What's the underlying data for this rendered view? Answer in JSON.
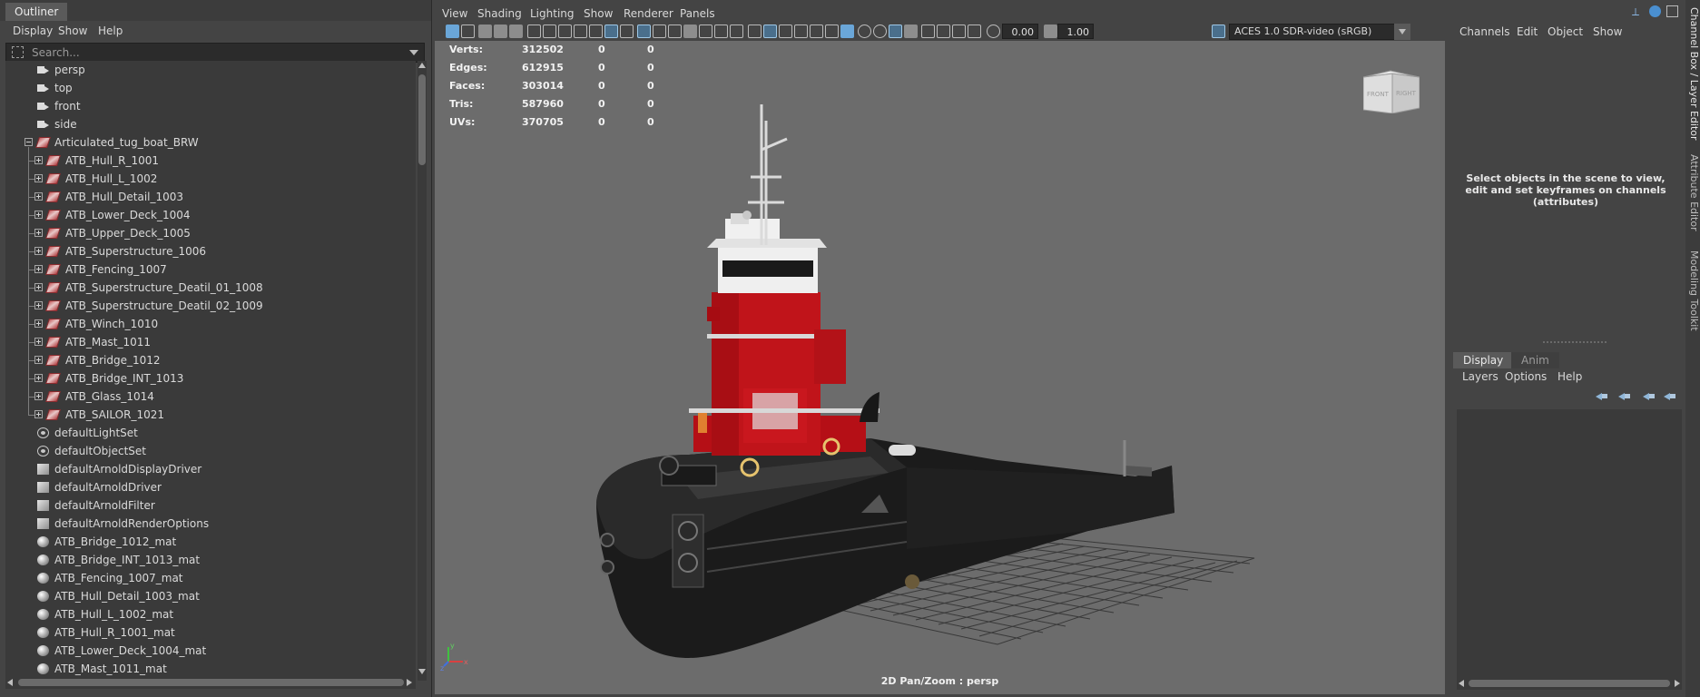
{
  "outliner": {
    "title": "Outliner",
    "menu": [
      "Display",
      "Show",
      "Help"
    ],
    "search_placeholder": "Search...",
    "items": [
      {
        "label": "persp",
        "kind": "camera",
        "indent": 0
      },
      {
        "label": "top",
        "kind": "camera",
        "indent": 0
      },
      {
        "label": "front",
        "kind": "camera",
        "indent": 0
      },
      {
        "label": "side",
        "kind": "camera",
        "indent": 0
      },
      {
        "label": "Articulated_tug_boat_BRW",
        "kind": "group",
        "indent": 0,
        "expanded": true
      },
      {
        "label": "ATB_Hull_R_1001",
        "kind": "mesh",
        "indent": 1
      },
      {
        "label": "ATB_Hull_L_1002",
        "kind": "mesh",
        "indent": 1
      },
      {
        "label": "ATB_Hull_Detail_1003",
        "kind": "mesh",
        "indent": 1
      },
      {
        "label": "ATB_Lower_Deck_1004",
        "kind": "mesh",
        "indent": 1
      },
      {
        "label": "ATB_Upper_Deck_1005",
        "kind": "mesh",
        "indent": 1
      },
      {
        "label": "ATB_Superstructure_1006",
        "kind": "mesh",
        "indent": 1
      },
      {
        "label": "ATB_Fencing_1007",
        "kind": "mesh",
        "indent": 1
      },
      {
        "label": "ATB_Superstructure_Deatil_01_1008",
        "kind": "mesh",
        "indent": 1
      },
      {
        "label": "ATB_Superstructure_Deatil_02_1009",
        "kind": "mesh",
        "indent": 1
      },
      {
        "label": "ATB_Winch_1010",
        "kind": "mesh",
        "indent": 1
      },
      {
        "label": "ATB_Mast_1011",
        "kind": "mesh",
        "indent": 1
      },
      {
        "label": "ATB_Bridge_1012",
        "kind": "mesh",
        "indent": 1
      },
      {
        "label": "ATB_Bridge_INT_1013",
        "kind": "mesh",
        "indent": 1
      },
      {
        "label": "ATB_Glass_1014",
        "kind": "mesh",
        "indent": 1
      },
      {
        "label": "ATB_SAILOR_1021",
        "kind": "mesh",
        "indent": 1
      },
      {
        "label": "defaultLightSet",
        "kind": "set",
        "indent": 0
      },
      {
        "label": "defaultObjectSet",
        "kind": "set",
        "indent": 0
      },
      {
        "label": "defaultArnoldDisplayDriver",
        "kind": "node",
        "indent": 0
      },
      {
        "label": "defaultArnoldDriver",
        "kind": "node",
        "indent": 0
      },
      {
        "label": "defaultArnoldFilter",
        "kind": "node",
        "indent": 0
      },
      {
        "label": "defaultArnoldRenderOptions",
        "kind": "node",
        "indent": 0
      },
      {
        "label": "ATB_Bridge_1012_mat",
        "kind": "material",
        "indent": 0
      },
      {
        "label": "ATB_Bridge_INT_1013_mat",
        "kind": "material",
        "indent": 0
      },
      {
        "label": "ATB_Fencing_1007_mat",
        "kind": "material",
        "indent": 0
      },
      {
        "label": "ATB_Hull_Detail_1003_mat",
        "kind": "material",
        "indent": 0
      },
      {
        "label": "ATB_Hull_L_1002_mat",
        "kind": "material",
        "indent": 0
      },
      {
        "label": "ATB_Hull_R_1001_mat",
        "kind": "material",
        "indent": 0
      },
      {
        "label": "ATB_Lower_Deck_1004_mat",
        "kind": "material",
        "indent": 0
      },
      {
        "label": "ATB_Mast_1011_mat",
        "kind": "material",
        "indent": 0
      }
    ]
  },
  "viewport": {
    "menu": [
      "View",
      "Shading",
      "Lighting",
      "Show",
      "Renderer",
      "Panels"
    ],
    "exposure": "0.00",
    "gamma": "1.00",
    "color_management": "ACES 1.0 SDR-video (sRGB)",
    "stats": [
      {
        "label": "Verts:",
        "values": [
          "312502",
          "0",
          "0"
        ]
      },
      {
        "label": "Edges:",
        "values": [
          "612915",
          "0",
          "0"
        ]
      },
      {
        "label": "Faces:",
        "values": [
          "303014",
          "0",
          "0"
        ]
      },
      {
        "label": "Tris:",
        "values": [
          "587960",
          "0",
          "0"
        ]
      },
      {
        "label": "UVs:",
        "values": [
          "370705",
          "0",
          "0"
        ]
      }
    ],
    "viewcube": {
      "front": "FRONT",
      "right": "RIGHT"
    },
    "camera_label": "2D Pan/Zoom : persp",
    "axis": {
      "x": "x",
      "y": "y",
      "z": "z"
    }
  },
  "channel_box": {
    "menu": [
      "Channels",
      "Edit",
      "Object",
      "Show"
    ],
    "message": [
      "Select objects in the scene to view,",
      "edit and set keyframes on channels",
      "(attributes)"
    ]
  },
  "side_tabs": [
    "Channel Box / Layer Editor",
    "Attribute Editor",
    "Modeling Toolkit"
  ],
  "layer_editor": {
    "tabs": [
      "Display",
      "Anim"
    ],
    "menu": [
      "Layers",
      "Options",
      "Help"
    ]
  },
  "colors": {
    "hull": "#1b1b1b",
    "superstructure": "#c0141a",
    "bridge": "#e6e6e6",
    "viewport_bg": "#6c6c6c",
    "grid": "#2e2e2e"
  }
}
